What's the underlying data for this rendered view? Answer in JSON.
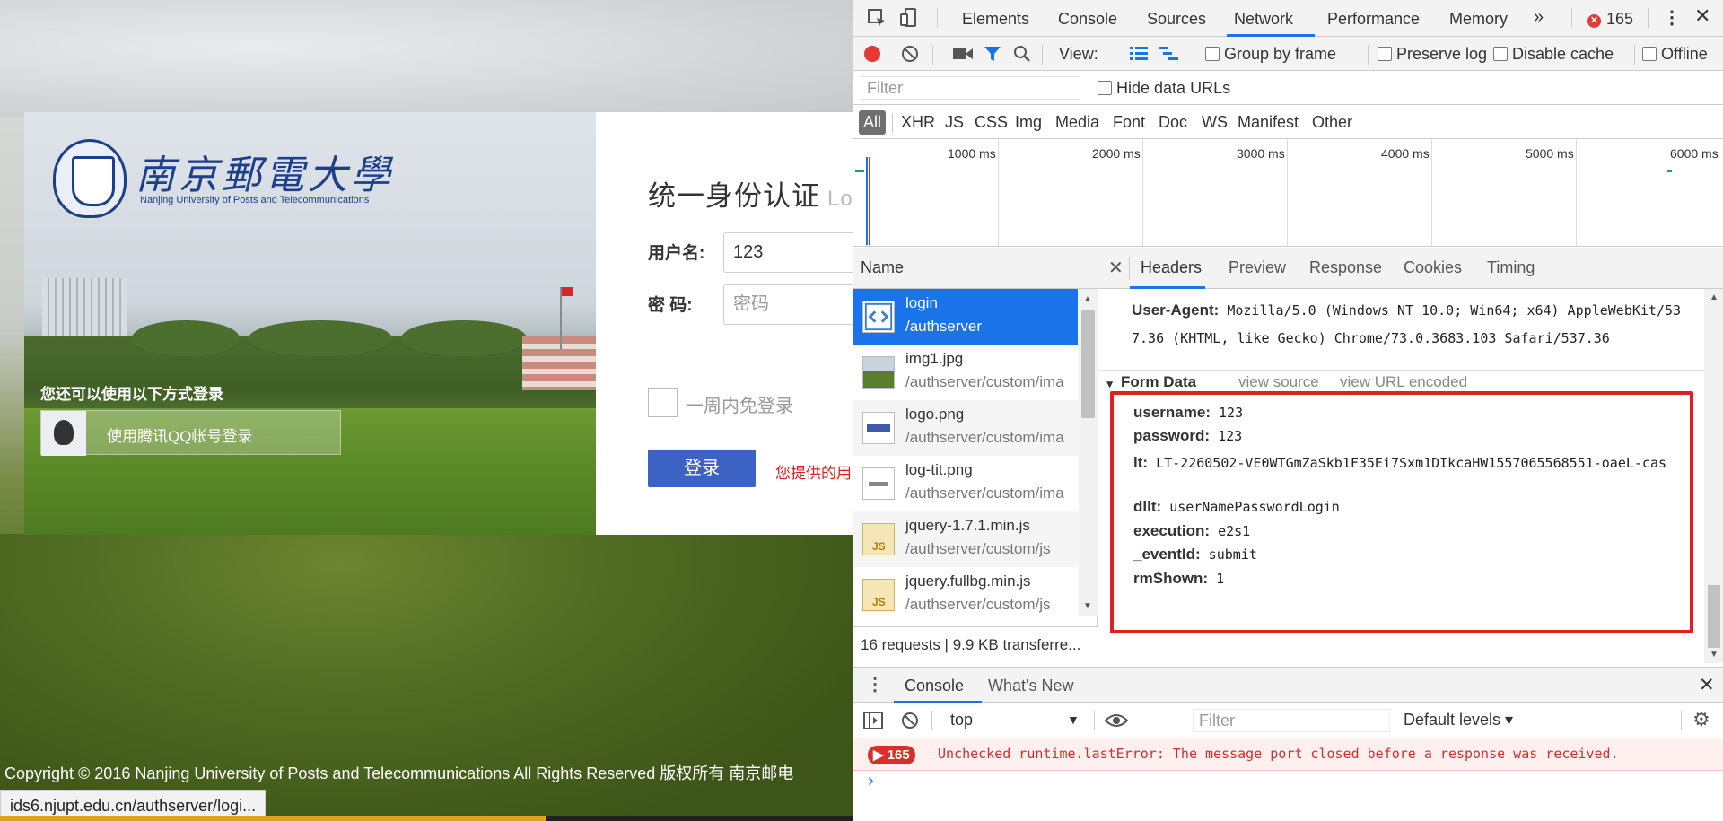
{
  "page": {
    "logo": {
      "cn": "南京郵電大學",
      "en": "Nanjing University of Posts and Telecommunications"
    },
    "alt_login_label": "您还可以使用以下方式登录",
    "qq_login_label": "使用腾讯QQ帐号登录",
    "form_title": "统一身份认证",
    "form_title_sub": "Login",
    "username_label": "用户名:",
    "username_value": "123",
    "password_label": "密 码:",
    "password_placeholder": "密码",
    "remember_label": "一周内免登录",
    "login_button": "登录",
    "error_message": "您提供的用",
    "copyright": "Copyright © 2016 Nanjing University of Posts and Telecommunications All Rights Reserved 版权所有 南京邮电",
    "status_url": "ids6.njupt.edu.cn/authserver/logi...",
    "load_progress": 0.64
  },
  "devtools": {
    "tabs": [
      "Elements",
      "Console",
      "Sources",
      "Network",
      "Performance",
      "Memory"
    ],
    "active_tab": "Network",
    "more_tabs": "»",
    "error_count": "165",
    "toolbar": {
      "view_label": "View:",
      "group_by_frame": "Group by frame",
      "preserve_log": "Preserve log",
      "disable_cache": "Disable cache",
      "offline": "Offline"
    },
    "filter_placeholder": "Filter",
    "hide_data_urls": "Hide data URLs",
    "types": [
      "All",
      "XHR",
      "JS",
      "CSS",
      "Img",
      "Media",
      "Font",
      "Doc",
      "WS",
      "Manifest",
      "Other"
    ],
    "timeline_ticks": [
      "1000 ms",
      "2000 ms",
      "3000 ms",
      "4000 ms",
      "5000 ms",
      "6000 ms"
    ],
    "name_column": "Name",
    "requests": [
      {
        "name": "login",
        "path": "/authserver",
        "icon": "html-doc-icon"
      },
      {
        "name": "img1.jpg",
        "path": "/authserver/custom/ima",
        "icon": "image-icon"
      },
      {
        "name": "logo.png",
        "path": "/authserver/custom/ima",
        "icon": "image-icon"
      },
      {
        "name": "log-tit.png",
        "path": "/authserver/custom/ima",
        "icon": "image-icon"
      },
      {
        "name": "jquery-1.7.1.min.js",
        "path": "/authserver/custom/js",
        "icon": "js-icon"
      },
      {
        "name": "jquery.fullbg.min.js",
        "path": "/authserver/custom/js",
        "icon": "js-icon"
      }
    ],
    "footer": "16 requests | 9.9 KB transferre...",
    "detail_tabs": [
      "Headers",
      "Preview",
      "Response",
      "Cookies",
      "Timing"
    ],
    "active_detail_tab": "Headers",
    "user_agent_key": "User-Agent:",
    "user_agent_value": "Mozilla/5.0 (Windows NT 10.0; Win64; x64) AppleWebKit/537.36 (KHTML, like Gecko) Chrome/73.0.3683.103 Safari/537.36",
    "form_data": {
      "title": "Form Data",
      "view_source": "view source",
      "view_url_encoded": "view URL encoded",
      "fields": [
        {
          "key": "username:",
          "value": "123"
        },
        {
          "key": "password:",
          "value": "123"
        },
        {
          "key": "lt:",
          "value": "LT-2260502-VE0WTGmZaSkb1F35Ei7Sxm1DIkcaHW1557065568551-oaeL-cas"
        },
        {
          "key": "dllt:",
          "value": "userNamePasswordLogin"
        },
        {
          "key": "execution:",
          "value": "e2s1"
        },
        {
          "key": "_eventId:",
          "value": "submit"
        },
        {
          "key": "rmShown:",
          "value": "1"
        }
      ]
    },
    "drawer_tabs": [
      "Console",
      "What's New"
    ],
    "console_context": "top",
    "console_filter_placeholder": "Filter",
    "console_levels": "Default levels ▾",
    "console_error_count": "165",
    "console_error_text": "Unchecked runtime.lastError: The message port closed before a response was received.",
    "colors": {
      "accent": "#1a73e8",
      "error": "#d93025",
      "login_button": "#3c63c3",
      "highlight_box": "#e02020"
    }
  }
}
